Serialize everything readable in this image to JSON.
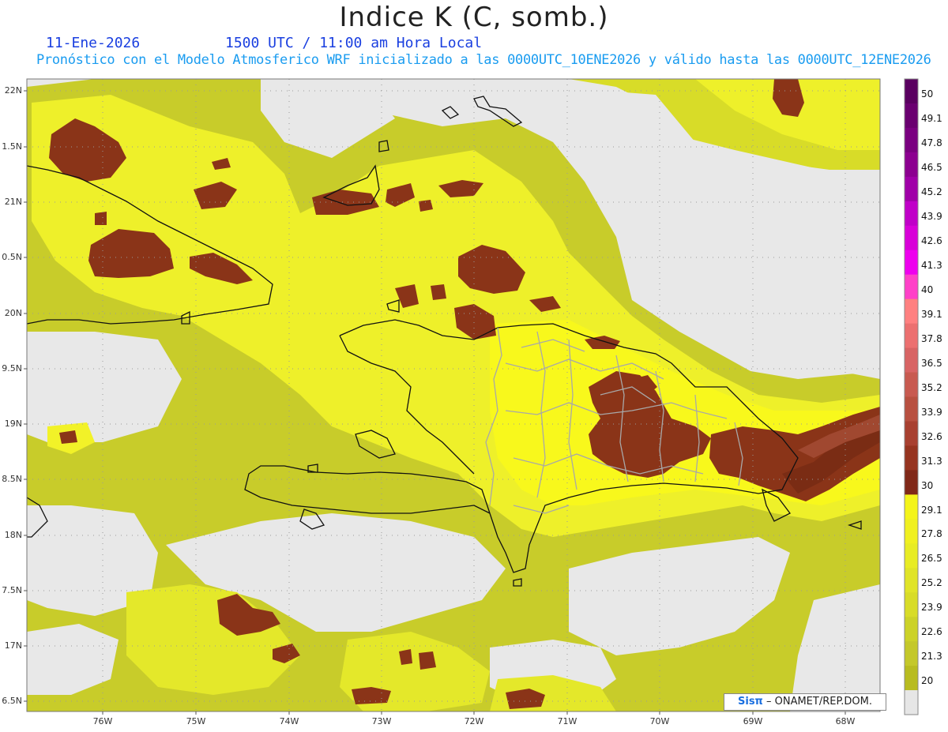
{
  "header": {
    "title": "Indice K (C, somb.)",
    "date": "11-Ene-2026",
    "time": "1500 UTC / 11:00 am Hora Local",
    "description": "Pronóstico con el Modelo Atmosferico WRF inicializado a las 0000UTC_10ENE2026 y válido hasta las  0000UTC_12ENE2026"
  },
  "axes": {
    "y_labels": [
      "22N",
      "1.5N",
      "21N",
      "0.5N",
      "20N",
      "9.5N",
      "19N",
      "8.5N",
      "18N",
      "7.5N",
      "17N",
      "6.5N"
    ],
    "x_labels": [
      "76W",
      "75W",
      "74W",
      "73W",
      "72W",
      "71W",
      "70W",
      "69W",
      "68W"
    ]
  },
  "colorbar": {
    "labels": [
      "50",
      "49.1",
      "47.8",
      "46.5",
      "45.2",
      "43.9",
      "42.6",
      "41.3",
      "40",
      "39.1",
      "37.8",
      "36.5",
      "35.2",
      "33.9",
      "32.6",
      "31.3",
      "30",
      "29.1",
      "27.8",
      "26.5",
      "25.2",
      "23.9",
      "22.6",
      "21.3",
      "20"
    ],
    "colors": [
      "#5a0060",
      "#6a0070",
      "#7a0080",
      "#8c0090",
      "#a000a8",
      "#c000c8",
      "#d800d8",
      "#ee00ee",
      "#ff40c8",
      "#ff8080",
      "#ec7070",
      "#d86464",
      "#c85a50",
      "#b85040",
      "#a84030",
      "#963420",
      "#802818",
      "#f4f41a",
      "#f0f020",
      "#e8ec24",
      "#e0e428",
      "#d8dc28",
      "#ccd228",
      "#c4c82a",
      "#b8bc20",
      "#e6e6e6"
    ]
  },
  "credit": {
    "brand": "Sisπ",
    "text": " – ONAMET/REP.DOM."
  }
}
